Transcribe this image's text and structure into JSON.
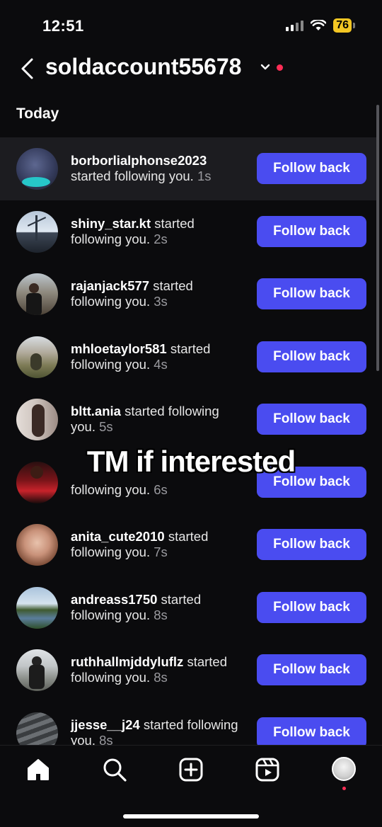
{
  "status_bar": {
    "time": "12:51",
    "battery": "76"
  },
  "header": {
    "account_name": "soldaccount55678"
  },
  "section": {
    "label": "Today"
  },
  "notifications": [
    {
      "username": "borborlialphonse2023",
      "text": "started following you.",
      "time": "1s",
      "button": "Follow back"
    },
    {
      "username": "shiny_star.kt",
      "text": "started following you.",
      "time": "2s",
      "button": "Follow back"
    },
    {
      "username": "rajanjack577",
      "text": "started following you.",
      "time": "3s",
      "button": "Follow back"
    },
    {
      "username": "mhloetaylor581",
      "text": "started following you.",
      "time": "4s",
      "button": "Follow back"
    },
    {
      "username": "bltt.ania",
      "text": "started following you.",
      "time": "5s",
      "button": "Follow back"
    },
    {
      "username": "",
      "text": "following you.",
      "time": "6s",
      "button": "Follow back"
    },
    {
      "username": "anita_cute2010",
      "text": "started following you.",
      "time": "7s",
      "button": "Follow back"
    },
    {
      "username": "andreass1750",
      "text": "started following you.",
      "time": "8s",
      "button": "Follow back"
    },
    {
      "username": "ruthhallmjddyluflz",
      "text": "started following you.",
      "time": "8s",
      "button": "Follow back"
    },
    {
      "username": "jjesse__j24",
      "text": "started following you.",
      "time": "8s",
      "button": "Follow back"
    }
  ],
  "overlay": {
    "caption": "TM if interested"
  },
  "tab_bar": {
    "items": [
      "home-icon",
      "search-icon",
      "create-icon",
      "reels-icon",
      "profile-icon"
    ]
  },
  "colors": {
    "accent": "#4a4cf0",
    "background": "#0b0b0d",
    "notification_dot": "#ff2d55"
  }
}
